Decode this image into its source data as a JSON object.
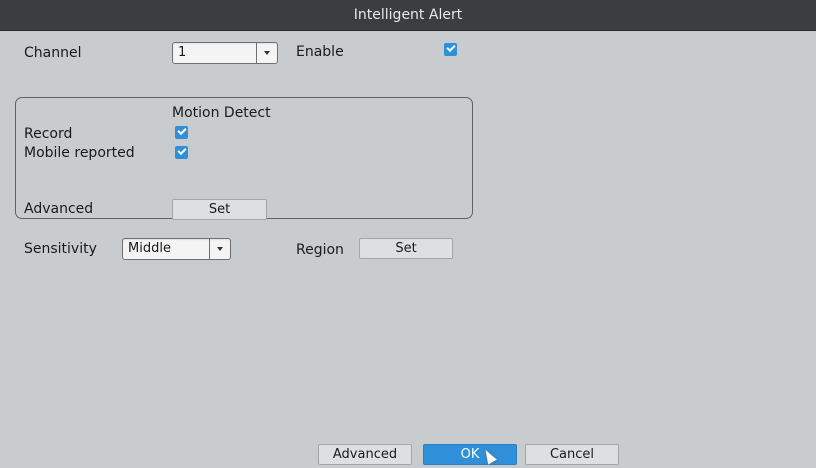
{
  "window": {
    "title": "Intelligent Alert"
  },
  "channel": {
    "label": "Channel",
    "value": "1"
  },
  "enable": {
    "label": "Enable",
    "checked": true
  },
  "group": {
    "title": "Motion Detect",
    "record": {
      "label": "Record",
      "checked": true
    },
    "mobile": {
      "label": "Mobile reported",
      "checked": true
    },
    "advanced": {
      "label": "Advanced",
      "button": "Set"
    }
  },
  "sensitivity": {
    "label": "Sensitivity",
    "value": "Middle"
  },
  "region": {
    "label": "Region",
    "button": "Set"
  },
  "footer": {
    "advanced": "Advanced",
    "ok": "OK",
    "cancel": "Cancel"
  },
  "colors": {
    "accent": "#2f8fd8",
    "background": "#c9ccce",
    "titlebar": "#3c3d3f"
  },
  "icons": {
    "dropdown": "chevron-down-icon",
    "check": "checkmark-icon",
    "pointer": "mouse-cursor-icon"
  }
}
